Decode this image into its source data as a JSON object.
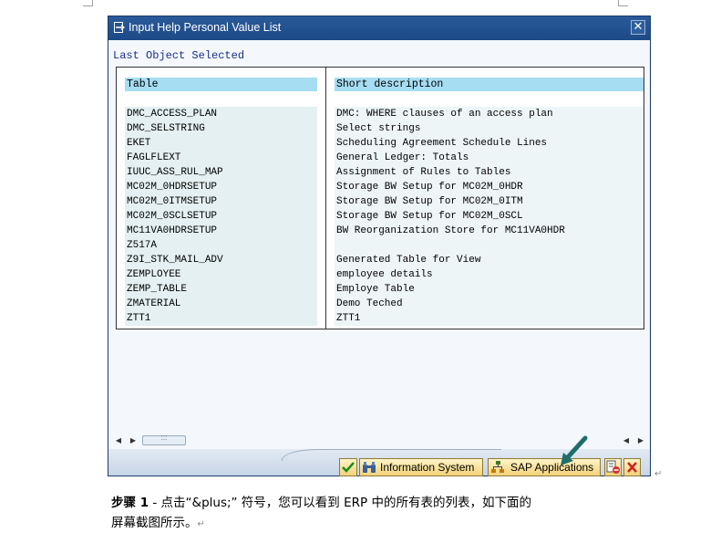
{
  "window": {
    "title": "Input Help Personal Value List",
    "close_glyph": "✕"
  },
  "heading": "Last Object Selected",
  "table": {
    "columns": [
      "Table",
      "Short description"
    ],
    "rows": [
      {
        "name": "DMC_ACCESS_PLAN",
        "desc": "DMC: WHERE clauses of an access plan"
      },
      {
        "name": "DMC_SELSTRING",
        "desc": "Select strings"
      },
      {
        "name": "EKET",
        "desc": "Scheduling Agreement Schedule Lines"
      },
      {
        "name": "FAGLFLEXT",
        "desc": "General Ledger: Totals"
      },
      {
        "name": "IUUC_ASS_RUL_MAP",
        "desc": "Assignment of Rules to Tables"
      },
      {
        "name": "MC02M_0HDRSETUP",
        "desc": "Storage BW Setup for MC02M_0HDR"
      },
      {
        "name": "MC02M_0ITMSETUP",
        "desc": "Storage BW Setup for MC02M_0ITM"
      },
      {
        "name": "MC02M_0SCLSETUP",
        "desc": "Storage BW Setup for MC02M_0SCL"
      },
      {
        "name": "MC11VA0HDRSETUP",
        "desc": "BW Reorganization Store for MC11VA0HDR"
      },
      {
        "name": "Z517A",
        "desc": ""
      },
      {
        "name": "Z9I_STK_MAIL_ADV",
        "desc": "Generated Table for View"
      },
      {
        "name": "ZEMPLOYEE",
        "desc": "employee details"
      },
      {
        "name": "ZEMP_TABLE",
        "desc": "Employe Table"
      },
      {
        "name": "ZMATERIAL",
        "desc": "Demo Teched"
      },
      {
        "name": "ZTT1",
        "desc": "ZTT1"
      }
    ]
  },
  "scrollbar": {
    "left_arrow": "◀",
    "right_arrow": "▶",
    "thumb_grip": ":::"
  },
  "footer": {
    "information_system_label": "Information System",
    "sap_applications_label": "SAP Applications",
    "accent_color": "#1f6e6a"
  },
  "paragraph": {
    "step_label": "步骤 1",
    "line1": " - 点击“&plus;” 符号，您可以看到 ERP 中的所有表的列表，如下面的",
    "line2": "屏幕截图所示。",
    "return_mark": "↵"
  }
}
